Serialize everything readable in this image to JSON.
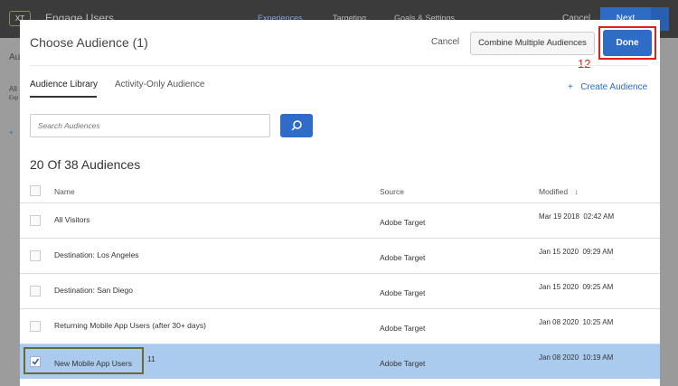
{
  "topbar": {
    "logo": "XT",
    "title": "Engage Users",
    "nav": [
      "Experiences",
      "Targeting",
      "Goals & Settings"
    ],
    "cancel": "Cancel",
    "next": "Next"
  },
  "background": {
    "heading": "Au",
    "item": "All",
    "sub": "Exp",
    "plus": "+"
  },
  "modal": {
    "title": "Choose Audience (1)",
    "cancel": "Cancel",
    "combine": "Combine Multiple Audiences",
    "done": "Done",
    "annotation_done": "12",
    "tabs": [
      "Audience Library",
      "Activity-Only Audience"
    ],
    "create": "Create Audience",
    "create_icon": "+",
    "search_placeholder": "Search Audiences",
    "count": "20 Of 38 Audiences",
    "columns": {
      "name": "Name",
      "source": "Source",
      "modified": "Modified"
    },
    "rows": [
      {
        "name": "All Visitors",
        "source": "Adobe Target",
        "modified": "Mar 19 2018  02:42 AM",
        "checked": false
      },
      {
        "name": "Destination: Los Angeles",
        "source": "Adobe Target",
        "modified": "Jan 15 2020  09:29 AM",
        "checked": false
      },
      {
        "name": "Destination: San Diego",
        "source": "Adobe Target",
        "modified": "Jan 15 2020  09:25 AM",
        "checked": false
      },
      {
        "name": "Returning Mobile App Users (after 30+ days)",
        "source": "Adobe Target",
        "modified": "Jan 08 2020  10:25 AM",
        "checked": false
      },
      {
        "name": "New Mobile App Users",
        "source": "Adobe Target",
        "modified": "Jan 08 2020  10:19 AM",
        "checked": true
      }
    ],
    "annotation_row": "11"
  }
}
